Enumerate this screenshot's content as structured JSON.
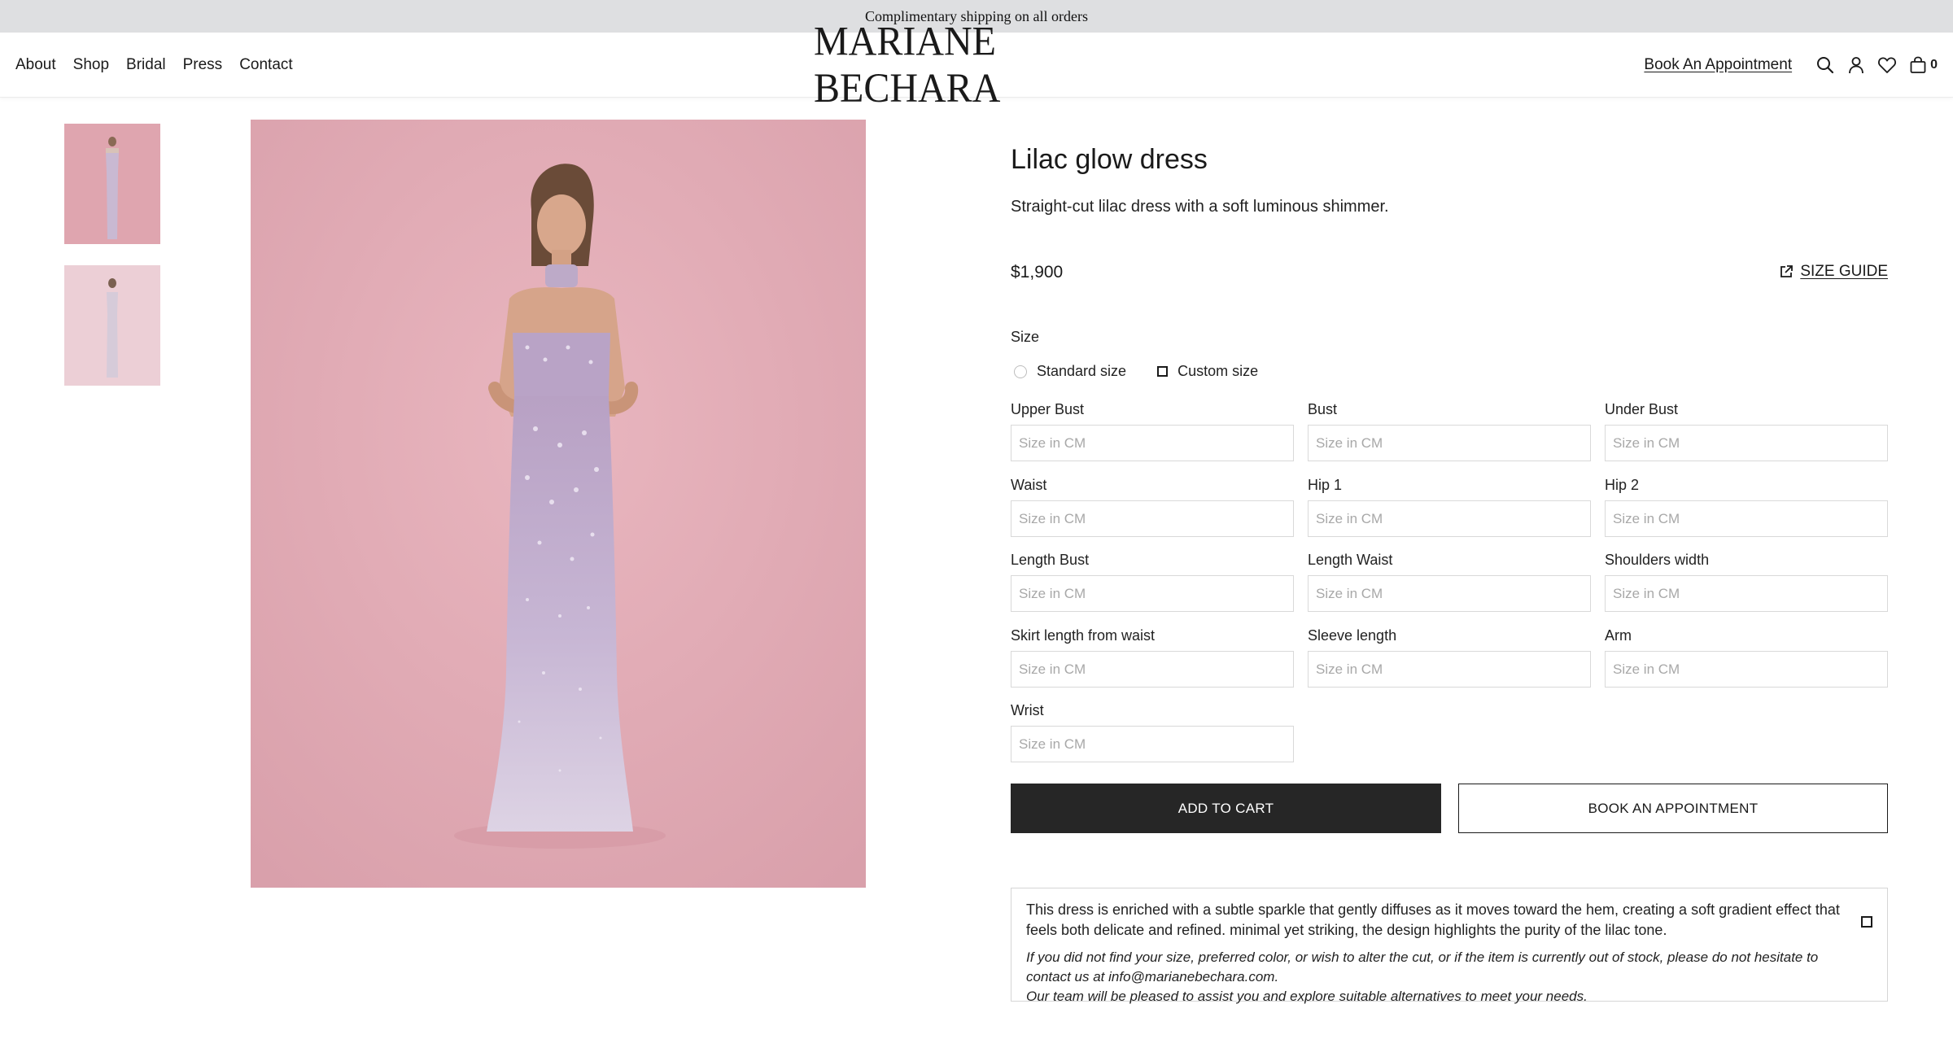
{
  "announcement": "Complimentary shipping on all orders",
  "brand": "MARIANE BECHARA",
  "nav": {
    "left": [
      "About",
      "Shop",
      "Bridal",
      "Press",
      "Contact"
    ],
    "book_appointment": "Book An Appointment",
    "icons": [
      "search-icon",
      "account-icon",
      "wishlist-heart-icon",
      "cart-bag-icon"
    ],
    "cart_count": "0"
  },
  "gallery": {
    "thumbnails": [
      "dress-front-view",
      "dress-back-view"
    ],
    "background_color": "#e8b2bb",
    "dress_color": "#c8b9d6"
  },
  "product": {
    "title": "Lilac glow dress",
    "short_description": "Straight-cut lilac dress with a soft luminous shimmer.",
    "price": "$1,900",
    "size_guide_label": "SIZE GUIDE",
    "size_label": "Size",
    "size_options": {
      "standard": "Standard size",
      "custom": "Custom size",
      "selected": "Custom size"
    },
    "measurement_placeholder": "Size in CM",
    "measurements": [
      "Upper Bust",
      "Bust",
      "Under Bust",
      "Waist",
      "Hip 1",
      "Hip 2",
      "Length Bust",
      "Length Waist",
      "Shoulders width",
      "Skirt length from waist",
      "Sleeve length",
      "Arm",
      "Wrist"
    ],
    "add_to_cart": "ADD TO CART",
    "book_appointment": "BOOK AN APPOINTMENT",
    "details": {
      "description": "This dress is enriched with a subtle sparkle that gently diffuses as it moves toward the hem, creating a soft gradient effect that feels both delicate and refined. minimal yet striking, the design highlights the purity of the lilac tone.",
      "note_line1": "If you did not find your size, preferred color, or wish to alter the cut, or if the item is currently out of stock, please do not hesitate to contact us at info@marianebechara.com.",
      "note_line2": "Our team will be pleased to assist you and explore suitable alternatives to meet your needs."
    }
  }
}
